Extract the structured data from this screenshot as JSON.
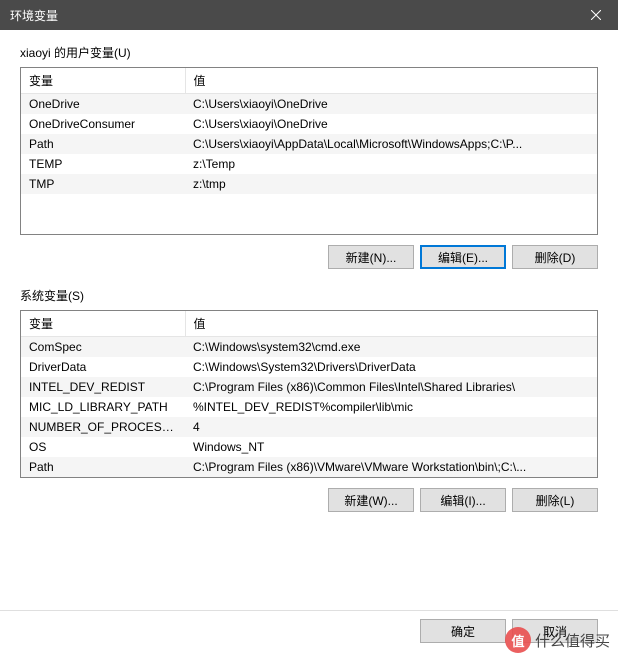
{
  "titlebar": {
    "title": "环境变量"
  },
  "user": {
    "label": "xiaoyi 的用户变量(U)",
    "headers": {
      "variable": "变量",
      "value": "值"
    },
    "rows": [
      {
        "variable": "OneDrive",
        "value": "C:\\Users\\xiaoyi\\OneDrive"
      },
      {
        "variable": "OneDriveConsumer",
        "value": "C:\\Users\\xiaoyi\\OneDrive"
      },
      {
        "variable": "Path",
        "value": "C:\\Users\\xiaoyi\\AppData\\Local\\Microsoft\\WindowsApps;C:\\P..."
      },
      {
        "variable": "TEMP",
        "value": "z:\\Temp"
      },
      {
        "variable": "TMP",
        "value": "z:\\tmp"
      }
    ],
    "buttons": {
      "new": "新建(N)...",
      "edit": "编辑(E)...",
      "delete": "删除(D)"
    }
  },
  "system": {
    "label": "系统变量(S)",
    "headers": {
      "variable": "变量",
      "value": "值"
    },
    "rows": [
      {
        "variable": "ComSpec",
        "value": "C:\\Windows\\system32\\cmd.exe"
      },
      {
        "variable": "DriverData",
        "value": "C:\\Windows\\System32\\Drivers\\DriverData"
      },
      {
        "variable": "INTEL_DEV_REDIST",
        "value": "C:\\Program Files (x86)\\Common Files\\Intel\\Shared Libraries\\"
      },
      {
        "variable": "MIC_LD_LIBRARY_PATH",
        "value": "%INTEL_DEV_REDIST%compiler\\lib\\mic"
      },
      {
        "variable": "NUMBER_OF_PROCESSORS",
        "value": "4"
      },
      {
        "variable": "OS",
        "value": "Windows_NT"
      },
      {
        "variable": "Path",
        "value": "C:\\Program Files (x86)\\VMware\\VMware Workstation\\bin\\;C:\\..."
      }
    ],
    "buttons": {
      "new": "新建(W)...",
      "edit": "编辑(I)...",
      "delete": "删除(L)"
    }
  },
  "dialog": {
    "ok": "确定",
    "cancel": "取消"
  },
  "watermark": {
    "badge": "值",
    "text": "什么值得买"
  }
}
